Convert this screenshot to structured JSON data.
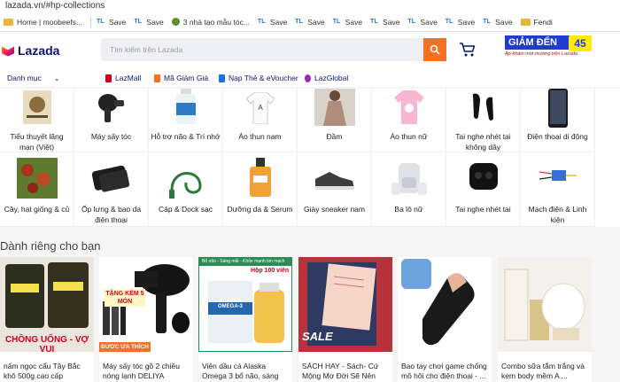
{
  "browser": {
    "url": "lazada.vn/#hp-collections",
    "bookmarks": [
      {
        "label": "Home | moobeefs...",
        "icon": "folder-icon"
      },
      {
        "label": "Save",
        "icon": "tl-icon"
      },
      {
        "label": "Save",
        "icon": "tl-icon"
      },
      {
        "label": "3 nhà tạo mẫu tóc...",
        "icon": "globe-icon"
      },
      {
        "label": "Save",
        "icon": "tl-icon"
      },
      {
        "label": "Save",
        "icon": "tl-icon"
      },
      {
        "label": "Save",
        "icon": "tl-icon"
      },
      {
        "label": "Save",
        "icon": "tl-icon"
      },
      {
        "label": "Save",
        "icon": "tl-icon"
      },
      {
        "label": "Save",
        "icon": "tl-icon"
      },
      {
        "label": "Save",
        "icon": "tl-icon"
      },
      {
        "label": "Fendi",
        "icon": "folder-icon"
      }
    ],
    "tl_prefix": "TL"
  },
  "header": {
    "logo": "Lazada",
    "search_placeholder": "Tìm kiếm trên Lazada",
    "promo_text": "GIẢM ĐẾN",
    "promo_num": "45",
    "promo_sub": "Áp khám mới mường trên Lazada"
  },
  "nav": {
    "category": "Danh mục",
    "items": [
      {
        "label": "LazMall",
        "color": "#d0021b"
      },
      {
        "label": "Mã Giảm Giá",
        "color": "#f57224"
      },
      {
        "label": "Nạp Thẻ & eVoucher",
        "color": "#1a73e8"
      },
      {
        "label": "LazGlobal",
        "color": "#9c27b0"
      }
    ]
  },
  "categories_top": [
    {
      "label": "Tiểu thuyết lãng mạn (Việt)"
    },
    {
      "label": "Máy sấy tóc"
    },
    {
      "label": "Hỗ trợ não & Trí nhớ"
    },
    {
      "label": "Áo thun nam"
    },
    {
      "label": "Đầm"
    },
    {
      "label": "Áo thun nữ"
    },
    {
      "label": "Tai nghe nhét tai không dây"
    },
    {
      "label": "Điện thoại di động"
    }
  ],
  "categories_bottom": [
    {
      "label": "Cây, hạt giống & củ"
    },
    {
      "label": "Ốp lưng & bao da điện thoại"
    },
    {
      "label": "Cáp & Dock sạc"
    },
    {
      "label": "Dưỡng da & Serum"
    },
    {
      "label": "Giày sneaker nam"
    },
    {
      "label": "Ba lô nữ"
    },
    {
      "label": "Tai nghe nhét tai"
    },
    {
      "label": "Mạch điện & Linh kiện"
    }
  ],
  "for_you_title": "Dành riêng cho bạn",
  "products": [
    {
      "title": "nấm ngọc cẩu Tây Bắc khô 500g cao cấp",
      "img_text": "CHỒNG UỐNG - VỢ VUI"
    },
    {
      "title": "Máy sấy tóc gồ 2 chiều nóng lạnh DELIYA 2200w-...",
      "img_text": "TẶNG KÈM 5 MÓN",
      "img_badge": "ĐƯỢC ƯA THÍCH"
    },
    {
      "title": "Viên dầu cá Alaska Omega 3 bổ não, sáng mắt, khỏe ...",
      "img_text": "Hộp 100 viên",
      "img_top": "Bổ não - Sáng mắt - Khỏe mạnh tim mạch",
      "img_brand": "ALASKA OMEGA-3"
    },
    {
      "title": "SÁCH HAY - Sách- Cứ Mộng Mơ Đời Sẽ Nên Thơ",
      "img_text": "SALE"
    },
    {
      "title": "Bao tay chơi game chống mồ hôi cho điện thoại - ...",
      "img_text": ""
    },
    {
      "title": "Combo sữa tắm trắng và kem body mềm A ...",
      "img_text": ""
    }
  ]
}
